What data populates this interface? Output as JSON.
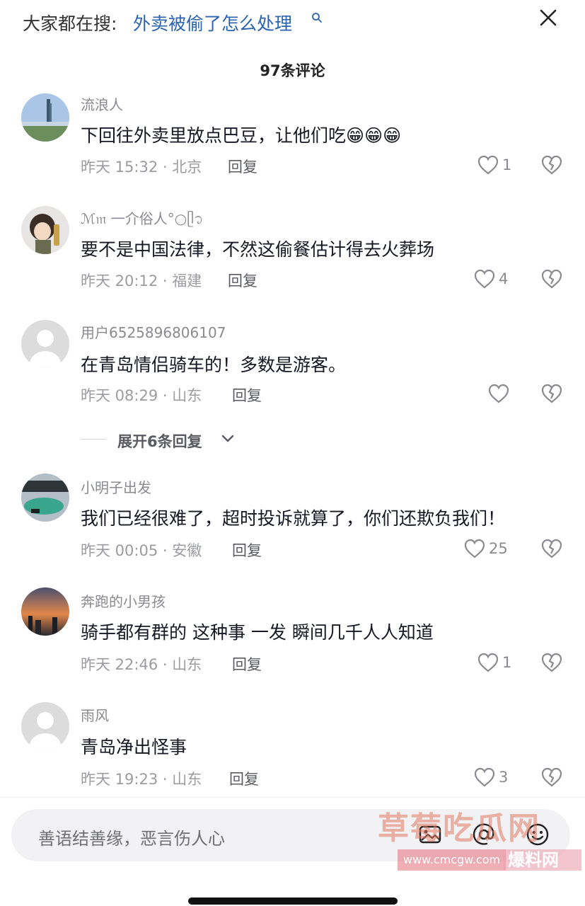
{
  "search": {
    "prefix": "大家都在搜:",
    "query": "外卖被偷了怎么处理"
  },
  "comment_count_label": "97条评论",
  "comments": [
    {
      "username": "流浪人",
      "content": "下回往外卖里放点巴豆，让他们吃",
      "emoji": [
        "😁",
        "😁",
        "😁"
      ],
      "time": "昨天 15:32",
      "location": "北京",
      "reply_label": "回复",
      "likes": "1"
    },
    {
      "username": "ℳ𝔪 一介俗人°○ᥫ᭡",
      "content": "要不是中国法律，不然这偷餐估计得去火葬场",
      "time": "昨天 20:12",
      "location": "福建",
      "reply_label": "回复",
      "likes": "4"
    },
    {
      "username": "用户6525896806107",
      "content": "在青岛情侣骑车的！多数是游客。",
      "time": "昨天 08:29",
      "location": "山东",
      "reply_label": "回复",
      "likes": ""
    },
    {
      "username": "小明子出发",
      "content": "我们已经很难了，超时投诉就算了，你们还欺负我们！",
      "time": "昨天 00:05",
      "location": "安徽",
      "reply_label": "回复",
      "likes": "25"
    },
    {
      "username": "奔跑的小男孩",
      "content": "骑手都有群的 这种事 一发  瞬间几千人人知道",
      "time": "昨天 22:46",
      "location": "山东",
      "reply_label": "回复",
      "likes": "1"
    },
    {
      "username": "雨风",
      "content": "青岛净出怪事",
      "time": "昨天 19:23",
      "location": "山东",
      "reply_label": "回复",
      "likes": "3"
    }
  ],
  "expand_replies_label": "展开6条回复",
  "input": {
    "placeholder": "善语结善缘，恶言伤人心"
  },
  "watermark": {
    "main": "草莓吃瓜网",
    "sub": "www.cmcgw.com",
    "sub2": "爆料网"
  },
  "colors": {
    "link_blue": "#2b63b0",
    "meta_gray": "#9b9ca2",
    "text": "#161823"
  },
  "icons": [
    "search-query-icon",
    "close-icon",
    "heart-icon",
    "broken-heart-icon",
    "chevron-down-icon",
    "image-icon",
    "mention-icon",
    "emoji-icon"
  ]
}
